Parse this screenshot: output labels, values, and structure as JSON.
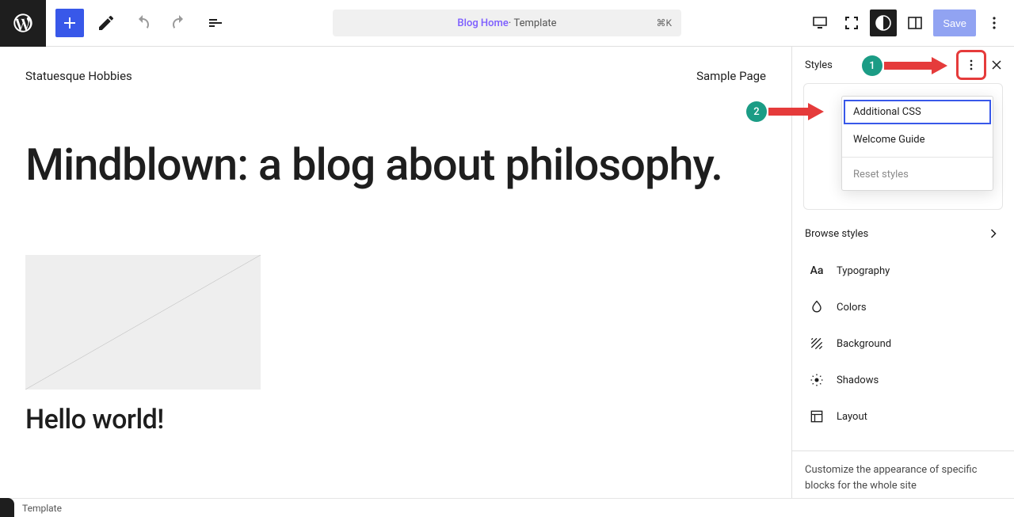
{
  "topbar": {
    "title_page": "Blog Home",
    "title_kind": "Template",
    "shortcut": "⌘K",
    "save_label": "Save"
  },
  "canvas": {
    "site_title": "Statuesque Hobbies",
    "nav_item": "Sample Page",
    "hero": "Mindblown: a blog about philosophy.",
    "post_title": "Hello world!"
  },
  "sidebar": {
    "title": "Styles",
    "browse": "Browse styles",
    "items": {
      "typography": "Typography",
      "colors": "Colors",
      "background": "Background",
      "shadows": "Shadows",
      "layout": "Layout"
    },
    "footer": "Customize the appearance of specific blocks for the whole site"
  },
  "dropdown": {
    "additional_css": "Additional CSS",
    "welcome_guide": "Welcome Guide",
    "reset": "Reset styles"
  },
  "bottom": {
    "crumb": "Template"
  },
  "annotations": {
    "b1": "1",
    "b2": "2"
  }
}
